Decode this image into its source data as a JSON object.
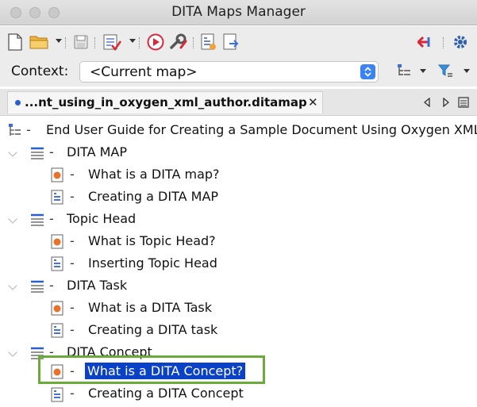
{
  "window": {
    "title": "DITA Maps Manager"
  },
  "toolbar": {
    "icons": [
      "new-file-icon",
      "open-folder-icon",
      "save-icon",
      "validate-icon",
      "transform-icon",
      "configure-transform-icon",
      "open-map-icon",
      "export-icon",
      "link-back-icon",
      "settings-icon"
    ]
  },
  "context": {
    "label": "Context:",
    "value": "<Current map>"
  },
  "tab": {
    "label": "...nt_using_in_oxygen_xml_author.ditamap",
    "close": "✕"
  },
  "tree": {
    "root": "End User Guide for Creating a Sample Document Using Oxygen XML",
    "groups": [
      {
        "label": "DITA MAP",
        "children": [
          "What is a DITA map?",
          "Creating a DITA MAP"
        ]
      },
      {
        "label": "Topic Head",
        "children": [
          "What is Topic Head?",
          "Inserting Topic Head"
        ]
      },
      {
        "label": "DITA Task",
        "children": [
          "What is a DITA Task",
          "Creating a DITA task"
        ]
      },
      {
        "label": "DITA Concept",
        "children": [
          "What is a DITA Concept?",
          "Creating a DITA Concept"
        ]
      }
    ],
    "selected": "What is a DITA Concept?"
  },
  "colors": {
    "selection": "#0a41c9",
    "highlight_outline": "#6aab3a",
    "topic_icon": "#e8732a"
  }
}
